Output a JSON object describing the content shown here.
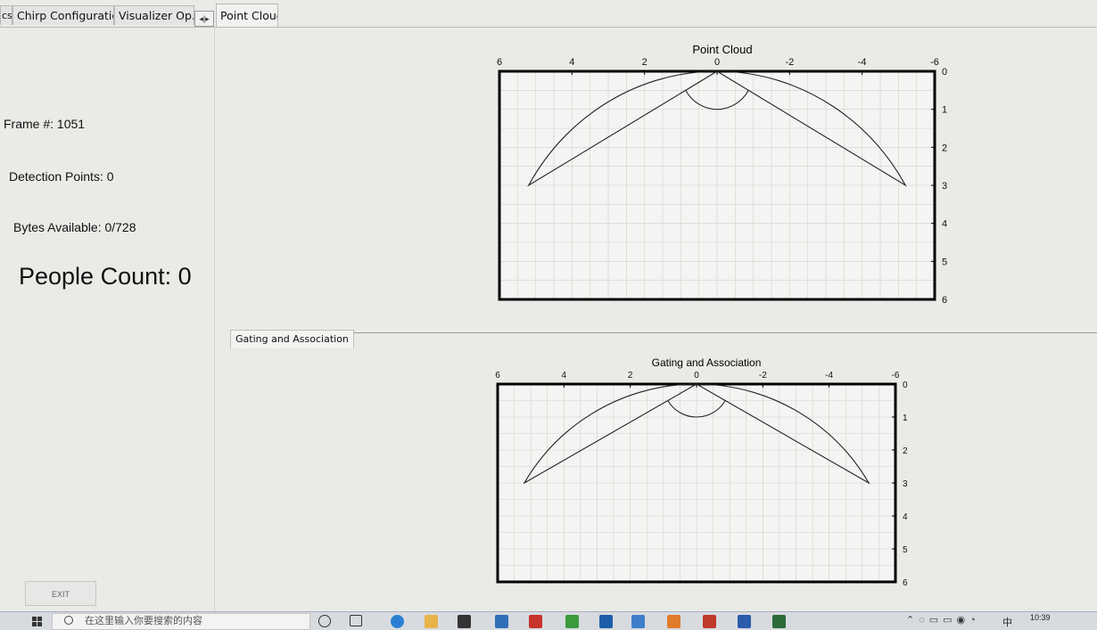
{
  "tabs": {
    "partial_label": "cs",
    "chirp_configuration": "Chirp Configuration",
    "visualizer_options": "Visualizer Op...",
    "scroll_arrows": "◂|▸",
    "point_cloud": "Point Cloud"
  },
  "stats": {
    "frame": "Frame #: 1051",
    "detection_points": "Detection Points: 0",
    "bytes_available": "Bytes Available: 0/728",
    "people_count": "People Count: 0"
  },
  "exit_label": "EXIT",
  "gating_tab": "Gating and Association",
  "plots": [
    {
      "title": "Point Cloud",
      "x_ticks": [
        "6",
        "4",
        "2",
        "0",
        "-2",
        "-4",
        "-6"
      ],
      "y_ticks": [
        "0",
        "1",
        "2",
        "3",
        "4",
        "5",
        "6"
      ]
    },
    {
      "title": "Gating and Association",
      "x_ticks": [
        "6",
        "4",
        "2",
        "0",
        "-2",
        "-4",
        "-6"
      ],
      "y_ticks": [
        "0",
        "1",
        "2",
        "3",
        "4",
        "5",
        "6"
      ]
    }
  ],
  "taskbar": {
    "search_placeholder": "在这里输入你要搜索的内容",
    "ime_label": "中",
    "clock": "10:39"
  },
  "colors": {
    "background": "#e9ebe7",
    "plot_background": "#f4f5f2",
    "grid": "#cfd1cd",
    "frame": "#000000"
  }
}
